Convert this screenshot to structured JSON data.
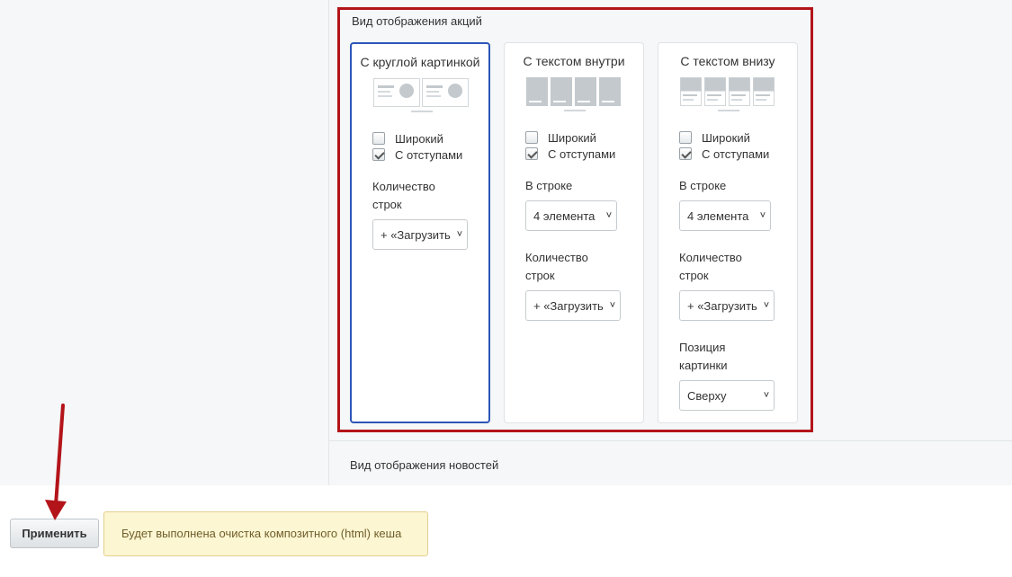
{
  "section": {
    "title": "Вид отображения акций",
    "cards": [
      {
        "title": "С круглой картинкой",
        "selected": true,
        "checks": [
          {
            "label": "Широкий",
            "checked": false
          },
          {
            "label": "С отступами",
            "checked": true
          }
        ],
        "rows_label": "Количество строк",
        "rows_value": "+ «Загрузить ещё»"
      },
      {
        "title": "С текстом внутри",
        "selected": false,
        "checks": [
          {
            "label": "Широкий",
            "checked": false
          },
          {
            "label": "С отступами",
            "checked": true
          }
        ],
        "per_row_label": "В строке",
        "per_row_value": "4 элемента",
        "rows_label": "Количество строк",
        "rows_value": "+ «Загрузить ещё»"
      },
      {
        "title": "С текстом внизу",
        "selected": false,
        "checks": [
          {
            "label": "Широкий",
            "checked": false
          },
          {
            "label": "С отступами",
            "checked": true
          }
        ],
        "per_row_label": "В строке",
        "per_row_value": "4 элемента",
        "rows_label": "Количество строк",
        "rows_value": "+ «Загрузить ещё»",
        "image_pos_label": "Позиция картинки",
        "image_pos_value": "Сверху"
      }
    ]
  },
  "news_section_label": "Вид отображения новостей",
  "footer": {
    "apply_label": "Применить",
    "notice": "Будет выполнена очистка композитного (html) кеша"
  },
  "colors": {
    "highlight_border": "#b3141a",
    "selected_card_border": "#2c56b8",
    "arrow": "#b3141a",
    "notice_bg": "#fdf6d2"
  }
}
